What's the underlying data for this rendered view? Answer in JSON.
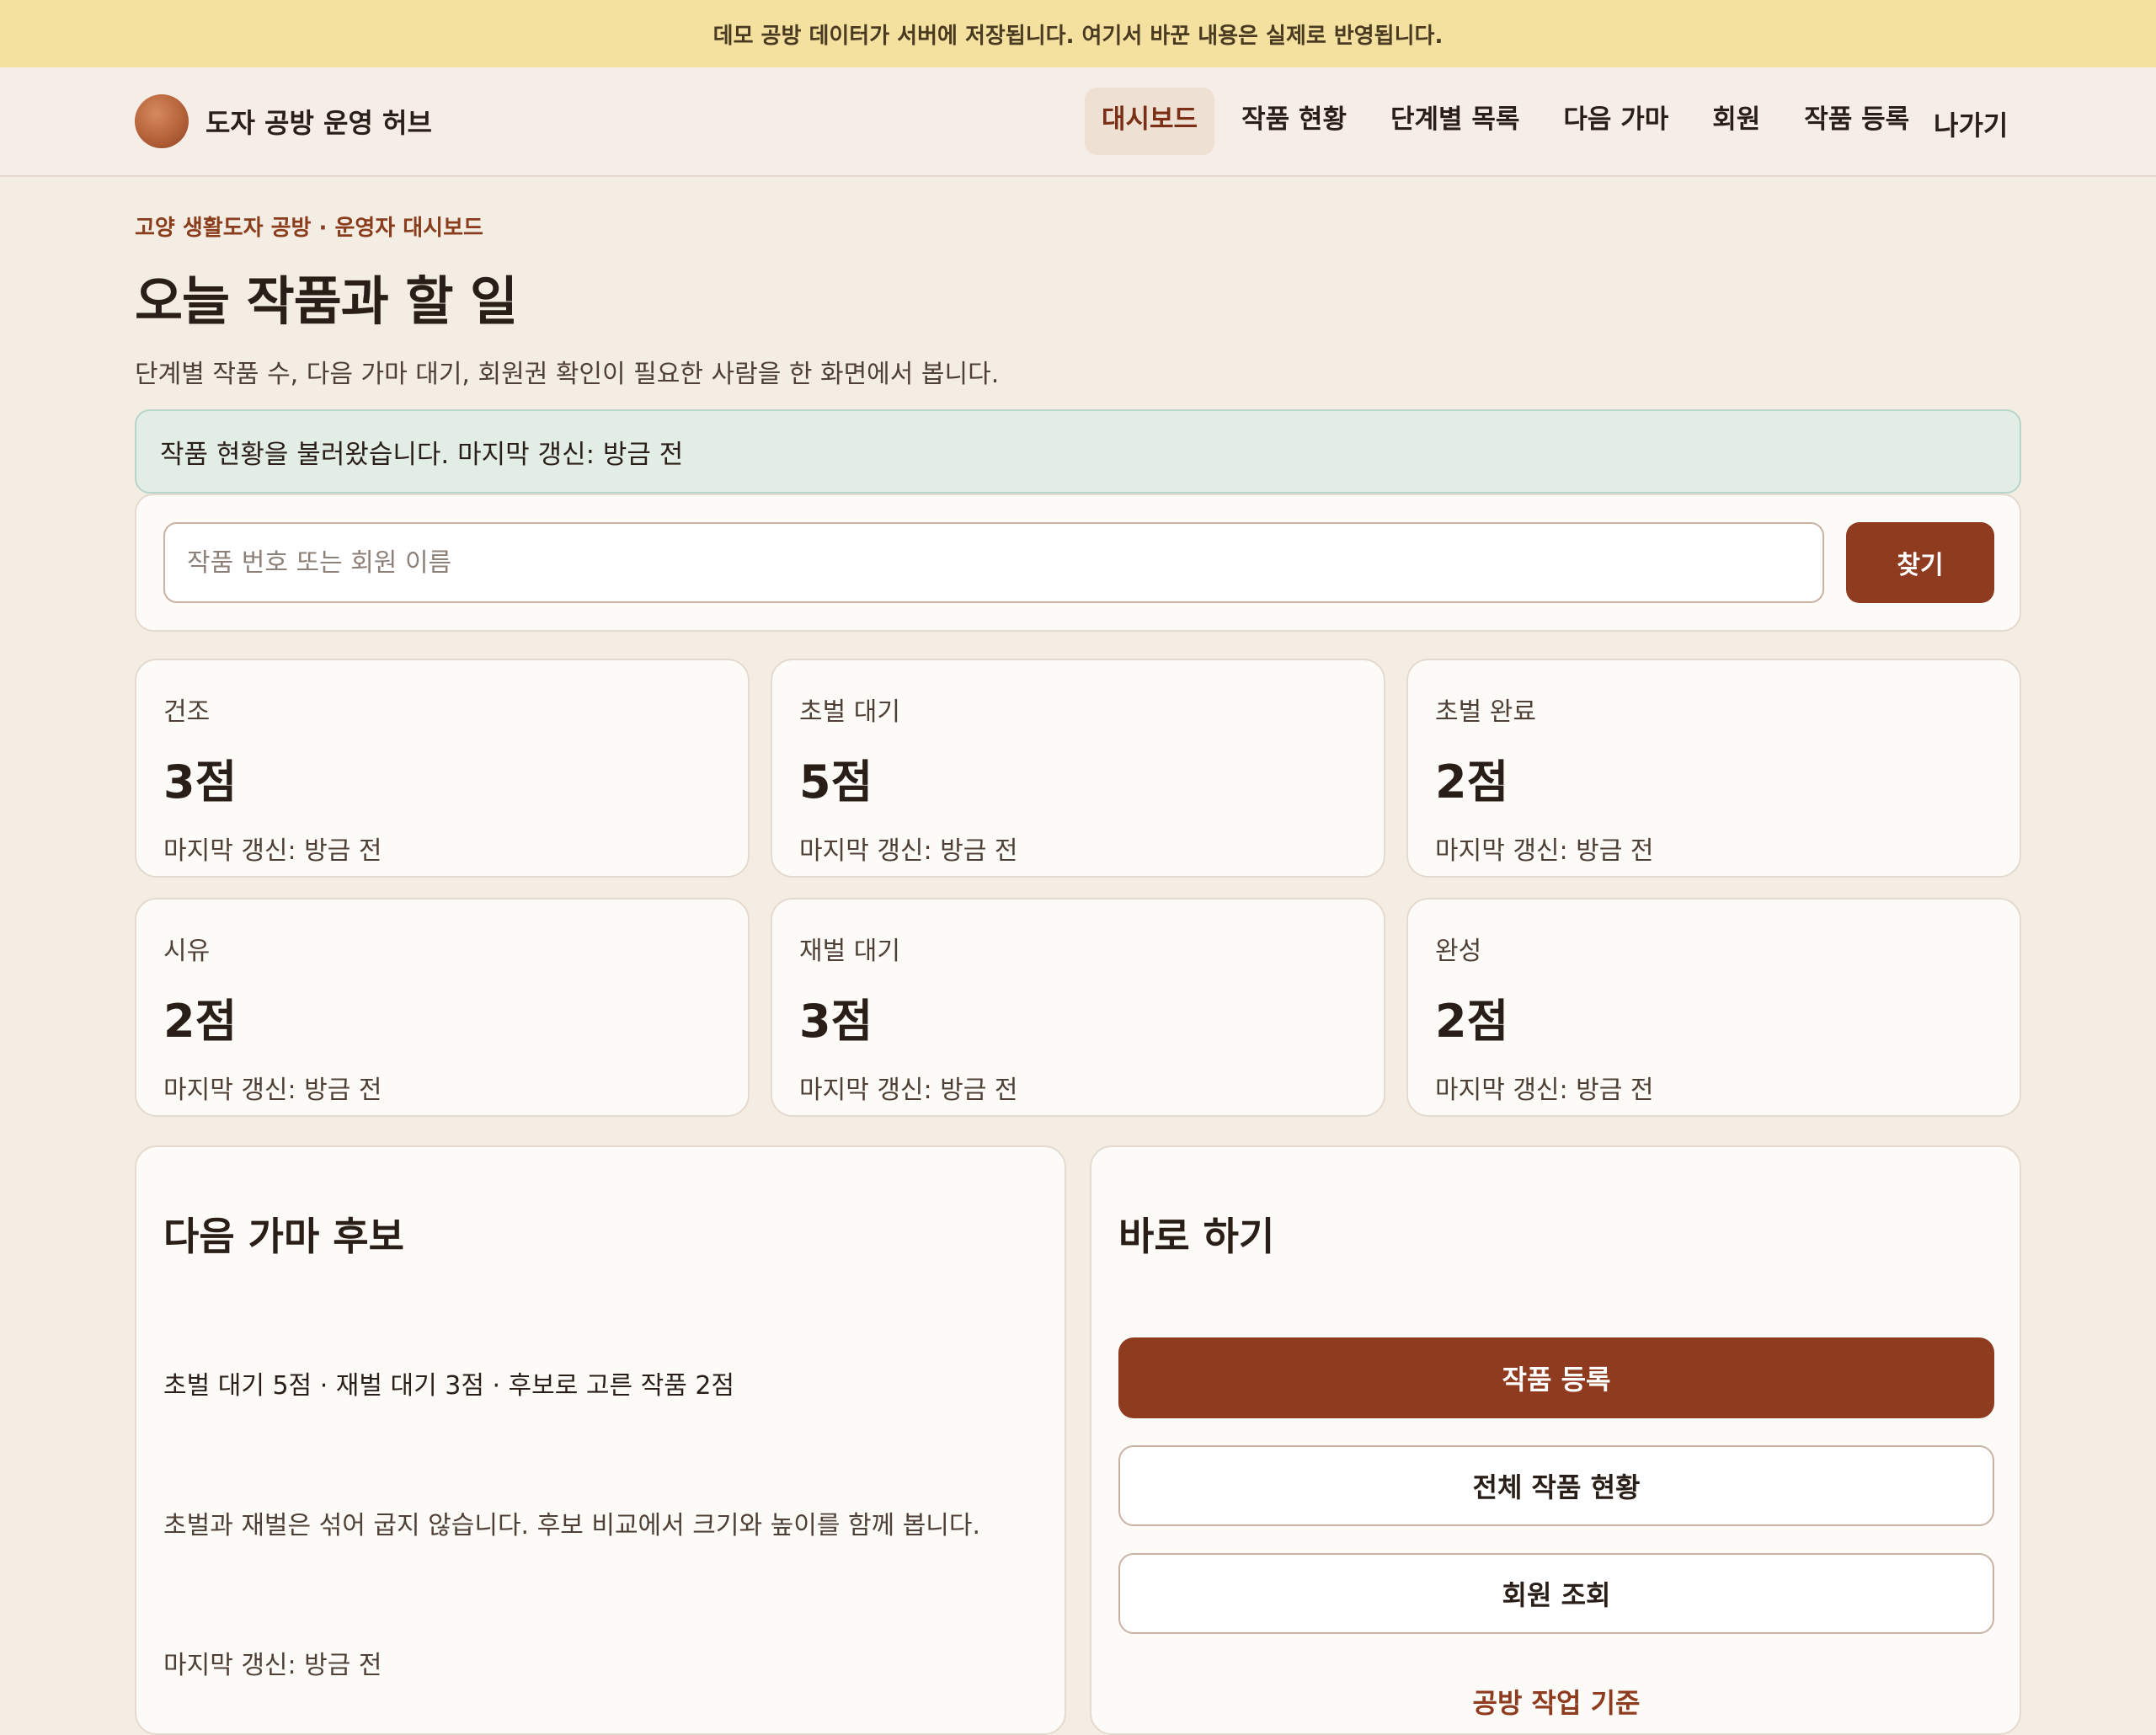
{
  "banner": {
    "text": "데모 공방 데이터가 서버에 저장됩니다. 여기서 바꾼 내용은 실제로 반영됩니다."
  },
  "brand": {
    "name": "도자 공방 운영 허브"
  },
  "nav": {
    "items": [
      {
        "label": "대시보드",
        "active": true
      },
      {
        "label": "작품 현황"
      },
      {
        "label": "단계별 목록"
      },
      {
        "label": "다음 가마"
      },
      {
        "label": "회원"
      },
      {
        "label": "작품 등록"
      }
    ],
    "logout": "나가기"
  },
  "header": {
    "eyebrow": "고양 생활도자 공방 · 운영자 대시보드",
    "title": "오늘 작품과 할 일",
    "description": "단계별 작품 수, 다음 가마 대기, 회원권 확인이 필요한 사람을 한 화면에서 봅니다."
  },
  "status": {
    "message": "작품 현황을 불러왔습니다. 마지막 갱신: 방금 전"
  },
  "search": {
    "placeholder": "작품 번호 또는 회원 이름",
    "button": "찾기"
  },
  "stats": [
    {
      "label": "건조",
      "value": "3점",
      "meta": "마지막 갱신: 방금 전"
    },
    {
      "label": "초벌 대기",
      "value": "5점",
      "meta": "마지막 갱신: 방금 전"
    },
    {
      "label": "초벌 완료",
      "value": "2점",
      "meta": "마지막 갱신: 방금 전"
    },
    {
      "label": "시유",
      "value": "2점",
      "meta": "마지막 갱신: 방금 전"
    },
    {
      "label": "재벌 대기",
      "value": "3점",
      "meta": "마지막 갱신: 방금 전"
    },
    {
      "label": "완성",
      "value": "2점",
      "meta": "마지막 갱신: 방금 전"
    }
  ],
  "kiln": {
    "title": "다음 가마 후보",
    "summary": "초벌 대기 5점 · 재벌 대기 3점 · 후보로 고른 작품 2점",
    "note": "초벌과 재벌은 섞어 굽지 않습니다. 후보 비교에서 크기와 높이를 함께 봅니다.",
    "meta": "마지막 갱신: 방금 전"
  },
  "quick": {
    "title": "바로 하기",
    "actions": [
      {
        "label": "작품 등록"
      },
      {
        "label": "전체 작품 현황"
      },
      {
        "label": "회원 조회"
      },
      {
        "label": "공방 작업 기준"
      }
    ]
  }
}
